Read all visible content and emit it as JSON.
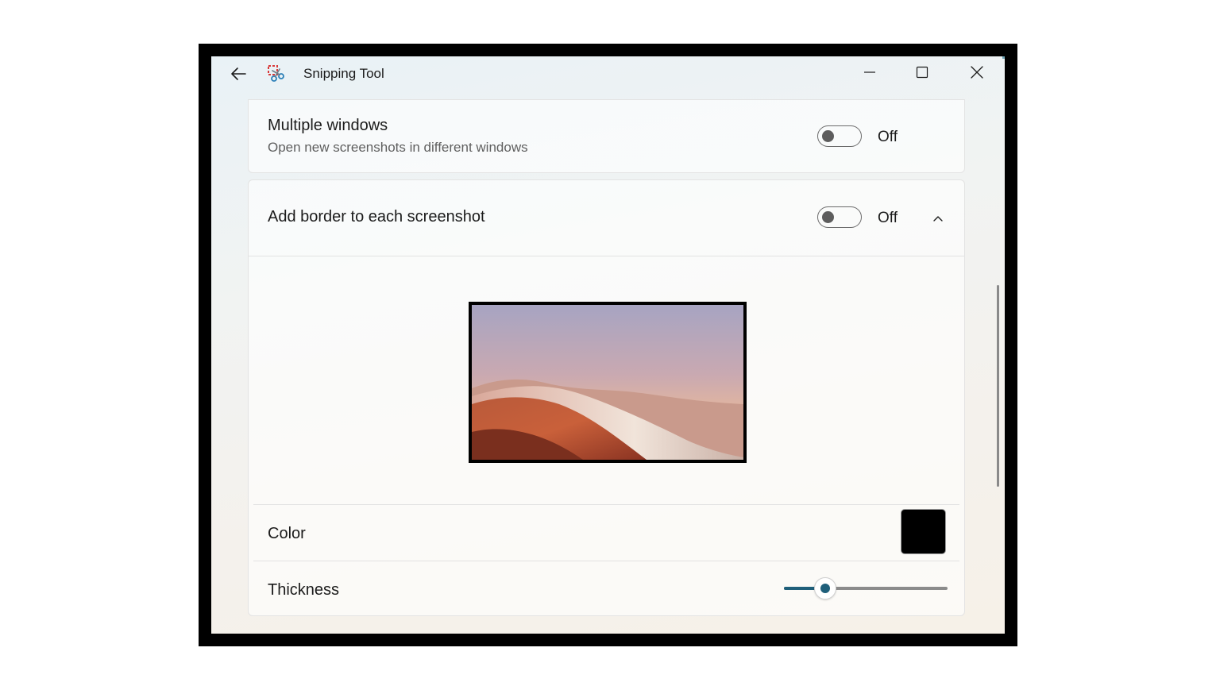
{
  "window": {
    "title": "Snipping Tool",
    "icons": {
      "back": "back-arrow-icon",
      "app": "snipping-tool-icon",
      "minimize": "minimize-icon",
      "maximize": "maximize-icon",
      "close": "close-icon"
    }
  },
  "settings": {
    "multiple_windows": {
      "title": "Multiple windows",
      "subtitle": "Open new screenshots in different windows",
      "state_label": "Off",
      "enabled": false
    },
    "add_border": {
      "title": "Add border to each screenshot",
      "state_label": "Off",
      "enabled": false,
      "expanded": true,
      "color": {
        "label": "Color",
        "value": "#000000"
      },
      "thickness": {
        "label": "Thickness",
        "fraction": 0.25
      }
    }
  },
  "colors": {
    "accent": "#1f5f7a",
    "border_color": "#000000"
  }
}
